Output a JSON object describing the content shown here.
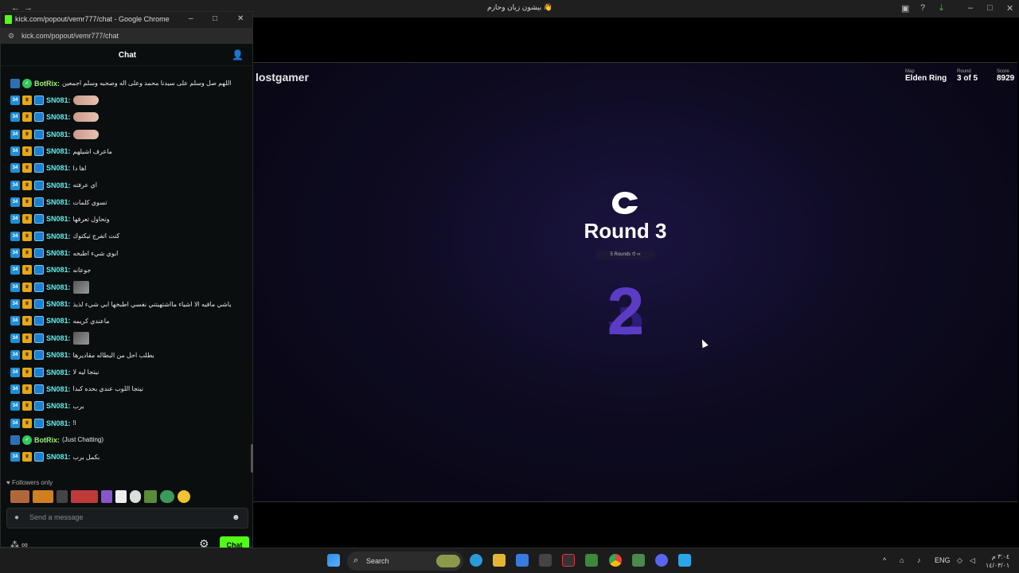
{
  "main_window": {
    "title": "بيشون زيان وحازم 👋",
    "game": {
      "player": "lostgamer",
      "map_label": "Map",
      "map_value": "Elden Ring",
      "round_label": "Round",
      "round_value": "3 of 5",
      "score_label": "Score",
      "score_value": "8929",
      "round_title": "Round 3",
      "round_sub": "5 Rounds  ⏱ ∞",
      "countdown": "2",
      "countdown_ghost": "3"
    }
  },
  "popout": {
    "title": "kick.com/popout/vemr777/chat - Google Chrome",
    "url": "kick.com/popout/vemr777/chat",
    "chat_title": "Chat",
    "messages": [
      {
        "user": "BotRix:",
        "text": "اللهم صل وسلم على سيدنا محمد وعلى اله وصحبه وسلم اجمعين",
        "type": "bot"
      },
      {
        "user": "SN081:",
        "text": "",
        "type": "emote"
      },
      {
        "user": "SN081:",
        "text": "",
        "type": "emote"
      },
      {
        "user": "SN081:",
        "text": "",
        "type": "emote"
      },
      {
        "user": "SN081:",
        "text": "ماعرف اشيلهم",
        "type": "text"
      },
      {
        "user": "SN081:",
        "text": "اها دا",
        "type": "text"
      },
      {
        "user": "SN081:",
        "text": "اي عرفته",
        "type": "text"
      },
      {
        "user": "SN081:",
        "text": "تسوي كلمات",
        "type": "text"
      },
      {
        "user": "SN081:",
        "text": "وتحاول تعرفها",
        "type": "text"
      },
      {
        "user": "SN081:",
        "text": "كنت اتفرج تيكتوك",
        "type": "text"
      },
      {
        "user": "SN081:",
        "text": "ابوي شيء اطبخه",
        "type": "text"
      },
      {
        "user": "SN081:",
        "text": "جوعانه",
        "type": "text"
      },
      {
        "user": "SN081:",
        "text": "",
        "type": "emote-sq"
      },
      {
        "user": "SN081:",
        "text": "ياشي مافيه الا اشياء مااشتهيتني نفسي اطبخها ابي شيء لذيذ",
        "type": "text"
      },
      {
        "user": "SN081:",
        "text": "ماعندي كريمه",
        "type": "text"
      },
      {
        "user": "SN081:",
        "text": "",
        "type": "emote-sq"
      },
      {
        "user": "SN081:",
        "text": "بطلب احل من البطاله مقاديرها",
        "type": "text"
      },
      {
        "user": "SN081:",
        "text": "نيتجا ليه لا",
        "type": "text"
      },
      {
        "user": "SN081:",
        "text": "نيتجا اللوب عندي بحده كبدا",
        "type": "text"
      },
      {
        "user": "SN081:",
        "text": "برب",
        "type": "text"
      },
      {
        "user": "SN081:",
        "text": "!l",
        "type": "text"
      },
      {
        "user": "BotRix:",
        "text": "(Just Chatting)",
        "type": "bot"
      },
      {
        "user": "SN081:",
        "text": "بكمل برب",
        "type": "text"
      }
    ],
    "followers_only": "♥ Followers only",
    "input_placeholder": "Send a message",
    "chat_button": "Chat"
  },
  "taskbar": {
    "search_label": "Search",
    "lang": "ENG",
    "time": "٣:٠٤ م",
    "date": "١٤/٠٣/٠١"
  },
  "colors": {
    "kick_green": "#53fc18",
    "username": "#5ef0f0",
    "countdown": "#5b3cc4"
  }
}
